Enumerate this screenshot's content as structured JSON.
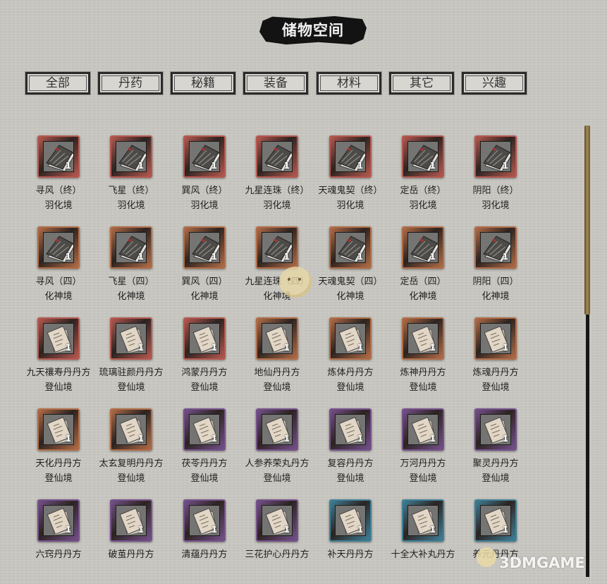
{
  "title": "储物空间",
  "tabs": [
    {
      "label": "全部"
    },
    {
      "label": "丹药"
    },
    {
      "label": "秘籍"
    },
    {
      "label": "装备"
    },
    {
      "label": "材料"
    },
    {
      "label": "其它"
    },
    {
      "label": "兴趣"
    }
  ],
  "items": [
    {
      "name": "寻风（终）",
      "realm": "羽化境",
      "count": "1",
      "frame": "red",
      "icon": "book-icon"
    },
    {
      "name": "飞星（终）",
      "realm": "羽化境",
      "count": "1",
      "frame": "red",
      "icon": "book-icon"
    },
    {
      "name": "巽风（终）",
      "realm": "羽化境",
      "count": "1",
      "frame": "red",
      "icon": "book-icon"
    },
    {
      "name": "九星连珠（终）",
      "realm": "羽化境",
      "count": "1",
      "frame": "red",
      "icon": "book-icon"
    },
    {
      "name": "天魂鬼契（终）",
      "realm": "羽化境",
      "count": "1",
      "frame": "red",
      "icon": "book-icon"
    },
    {
      "name": "定岳（终）",
      "realm": "羽化境",
      "count": "1",
      "frame": "red",
      "icon": "book-icon"
    },
    {
      "name": "阴阳（终）",
      "realm": "羽化境",
      "count": "1",
      "frame": "red",
      "icon": "book-icon"
    },
    {
      "name": "寻风（四）",
      "realm": "化神境",
      "count": "1",
      "frame": "copper",
      "icon": "book-icon"
    },
    {
      "name": "飞星（四）",
      "realm": "化神境",
      "count": "1",
      "frame": "copper",
      "icon": "book-icon"
    },
    {
      "name": "巽风（四）",
      "realm": "化神境",
      "count": "1",
      "frame": "copper",
      "icon": "book-icon"
    },
    {
      "name": "九星连珠（四）",
      "realm": "化神境",
      "count": "1",
      "frame": "copper",
      "icon": "book-icon"
    },
    {
      "name": "天魂鬼契（四）",
      "realm": "化神境",
      "count": "1",
      "frame": "copper",
      "icon": "book-icon"
    },
    {
      "name": "定岳（四）",
      "realm": "化神境",
      "count": "1",
      "frame": "copper",
      "icon": "book-icon"
    },
    {
      "name": "阴阳（四）",
      "realm": "化神境",
      "count": "1",
      "frame": "copper",
      "icon": "book-icon"
    },
    {
      "name": "九天禳寿丹丹方",
      "realm": "登仙境",
      "count": "1",
      "frame": "red",
      "icon": "recipe-icon"
    },
    {
      "name": "琉璃驻颜丹丹方",
      "realm": "登仙境",
      "count": "1",
      "frame": "red",
      "icon": "recipe-icon"
    },
    {
      "name": "鸿蒙丹丹方",
      "realm": "登仙境",
      "count": "1",
      "frame": "red",
      "icon": "recipe-icon"
    },
    {
      "name": "地仙丹丹方",
      "realm": "登仙境",
      "count": "1",
      "frame": "copper",
      "icon": "recipe-icon"
    },
    {
      "name": "炼体丹丹方",
      "realm": "登仙境",
      "count": "1",
      "frame": "copper",
      "icon": "recipe-icon"
    },
    {
      "name": "炼神丹丹方",
      "realm": "登仙境",
      "count": "1",
      "frame": "copper",
      "icon": "recipe-icon"
    },
    {
      "name": "炼魂丹丹方",
      "realm": "登仙境",
      "count": "1",
      "frame": "copper",
      "icon": "recipe-icon"
    },
    {
      "name": "天化丹丹方",
      "realm": "登仙境",
      "count": "1",
      "frame": "copper",
      "icon": "recipe-icon"
    },
    {
      "name": "太玄复明丹丹方",
      "realm": "登仙境",
      "count": "1",
      "frame": "copper",
      "icon": "recipe-icon"
    },
    {
      "name": "茯苓丹丹方",
      "realm": "登仙境",
      "count": "1",
      "frame": "purple",
      "icon": "recipe-icon"
    },
    {
      "name": "人参养荣丸丹方",
      "realm": "登仙境",
      "count": "1",
      "frame": "purple",
      "icon": "recipe-icon"
    },
    {
      "name": "复容丹丹方",
      "realm": "登仙境",
      "count": "1",
      "frame": "purple",
      "icon": "recipe-icon"
    },
    {
      "name": "万河丹丹方",
      "realm": "登仙境",
      "count": "1",
      "frame": "purple",
      "icon": "recipe-icon"
    },
    {
      "name": "聚灵丹丹方",
      "realm": "登仙境",
      "count": "1",
      "frame": "purple",
      "icon": "recipe-icon"
    },
    {
      "name": "六窍丹丹方",
      "realm": "",
      "count": "1",
      "frame": "purple",
      "icon": "recipe-icon"
    },
    {
      "name": "破茧丹丹方",
      "realm": "",
      "count": "1",
      "frame": "purple",
      "icon": "recipe-icon"
    },
    {
      "name": "清蕴丹丹方",
      "realm": "",
      "count": "1",
      "frame": "purple",
      "icon": "recipe-icon"
    },
    {
      "name": "三花护心丹丹方",
      "realm": "",
      "count": "1",
      "frame": "purple",
      "icon": "recipe-icon"
    },
    {
      "name": "补天丹丹方",
      "realm": "",
      "count": "1",
      "frame": "blue",
      "icon": "recipe-icon"
    },
    {
      "name": "十全大补丸丹方",
      "realm": "",
      "count": "1",
      "frame": "blue",
      "icon": "recipe-icon"
    },
    {
      "name": "养元丹丹方",
      "realm": "",
      "count": "1",
      "frame": "blue",
      "icon": "recipe-icon"
    }
  ],
  "frame_colors": {
    "red": "#b4584f",
    "copper": "#b06c47",
    "purple": "#74508a",
    "blue": "#3f7f97"
  },
  "watermark": "3DMGAME"
}
